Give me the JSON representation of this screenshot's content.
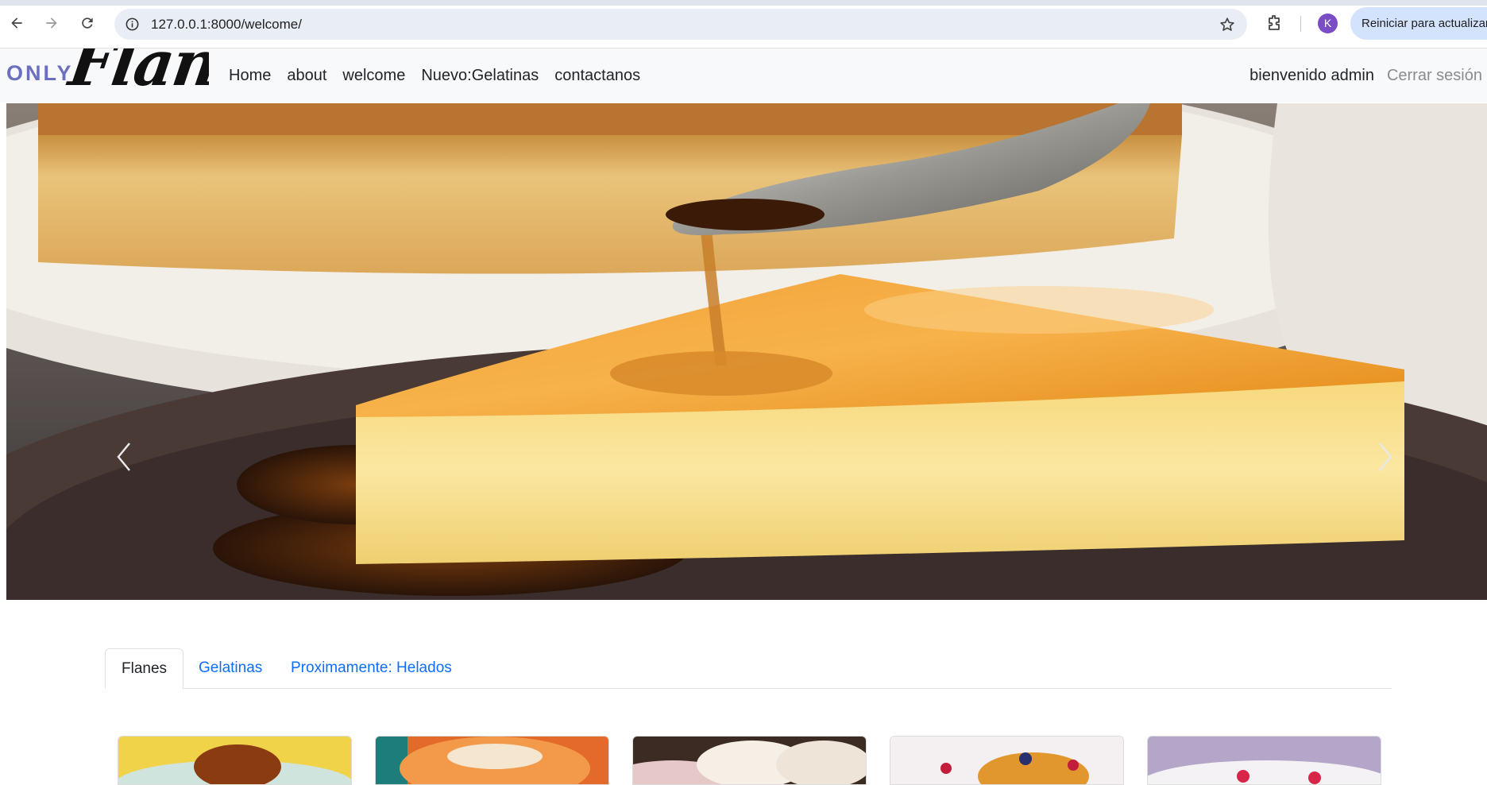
{
  "browser": {
    "url": "127.0.0.1:8000/welcome/",
    "profile_initial": "K",
    "update_button": "Reiniciar para actualizar"
  },
  "navbar": {
    "brand_only": "ONLY",
    "brand_flans": "Flans",
    "links": [
      "Home",
      "about",
      "welcome",
      "Nuevo:Gelatinas",
      "contactanos"
    ],
    "greeting": "bienvenido admin",
    "logout": "Cerrar sesión"
  },
  "carousel": {
    "image": "flan-caramel-spoon",
    "prev_icon": "chevron-left-icon",
    "next_icon": "chevron-right-icon"
  },
  "tabs": [
    {
      "label": "Flanes",
      "active": true
    },
    {
      "label": "Gelatinas",
      "active": false
    },
    {
      "label": "Proximamente: Helados",
      "active": false
    }
  ],
  "cards": [
    {
      "image": "flan-yellow-background"
    },
    {
      "image": "flan-orange-coconut"
    },
    {
      "image": "flan-coconut-dark"
    },
    {
      "image": "flan-berries-caramel"
    },
    {
      "image": "cake-raspberry"
    }
  ],
  "colors": {
    "link": "#0d6efd",
    "navbar_bg": "#f8f9fa",
    "brand_only": "#6c6fbf",
    "update_pill": "#d3e3fd"
  }
}
